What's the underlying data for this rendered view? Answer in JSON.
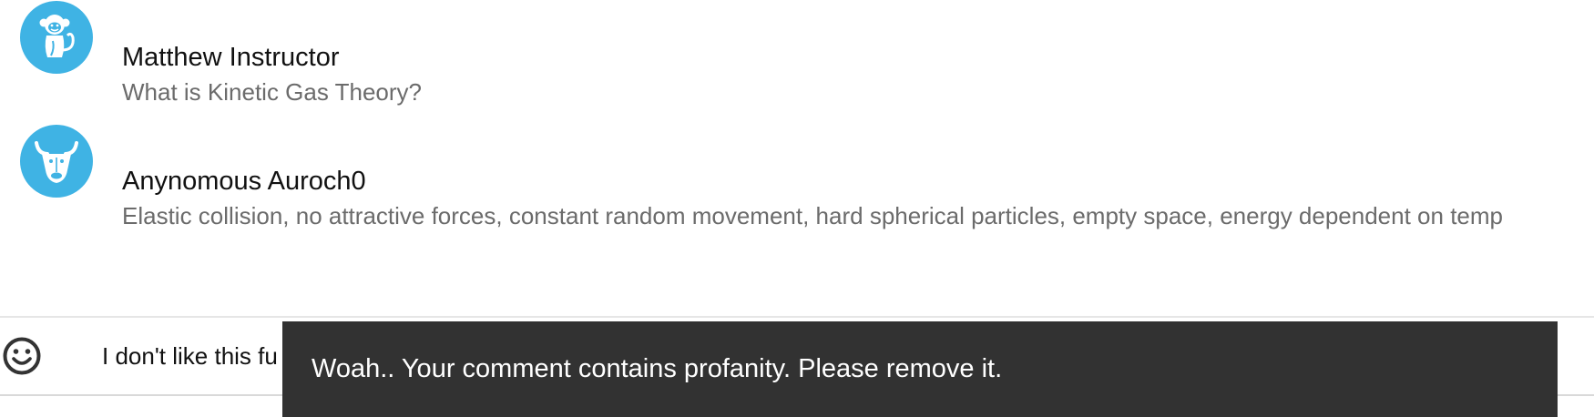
{
  "comments": [
    {
      "author": "Matthew Instructor",
      "text": "What is Kinetic Gas Theory?",
      "avatar_icon": "monkey-icon"
    },
    {
      "author": "Anynomous Auroch0",
      "text": "Elastic collision, no attractive forces, constant random movement, hard spherical particles, empty space, energy dependent on temp",
      "avatar_icon": "bull-icon"
    }
  ],
  "composer": {
    "emoji_icon": "smiley-icon",
    "value": "I don't like this fu",
    "placeholder": ""
  },
  "snackbar": {
    "message": "Woah.. Your comment contains profanity. Please remove it."
  },
  "colors": {
    "avatar": "#3fb3e4",
    "snackbar": "#323232",
    "author": "#111111",
    "comment_text": "#6b6b6b"
  }
}
